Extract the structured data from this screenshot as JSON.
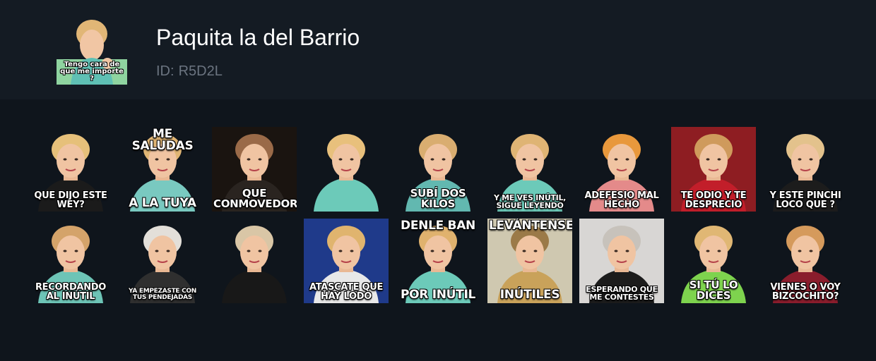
{
  "pack": {
    "title": "Paquita la del Barrio",
    "id_label": "ID:",
    "id_value": "R5D2L",
    "thumbnail_caption": "Tengo cara de que me importe ?"
  },
  "stickers": [
    {
      "top": "",
      "bottom": "Que dijo este wey?",
      "bg": "#0f151c",
      "shirt": "#1b1b1b",
      "hair": "#e6c07a"
    },
    {
      "top": "Me saludas",
      "bottom": "A la tuya",
      "bg": "#0f151c",
      "shirt": "#79c9c0",
      "hair": "#e0b574"
    },
    {
      "top": "",
      "bottom": "Que conmovedor",
      "bg": "#1a1410",
      "shirt": "#2a2420",
      "hair": "#9a6a48"
    },
    {
      "top": "",
      "bottom": "",
      "bg": "#0f151c",
      "shirt": "#6ccab9",
      "hair": "#e8c07c"
    },
    {
      "top": "",
      "bottom": "Subí dos kilos",
      "bg": "#0f151c",
      "shirt": "#62b8b0",
      "hair": "#d9ad70"
    },
    {
      "top": "",
      "bottom": "Y me ves inútil, sigue leyendo",
      "bg": "#0f151c",
      "shirt": "#6ccab9",
      "hair": "#dfb474"
    },
    {
      "top": "",
      "bottom": "Adefesio mal hecho",
      "bg": "#0f151c",
      "shirt": "#e48a8a",
      "hair": "#e8983c"
    },
    {
      "top": "",
      "bottom": "Te odio y te desprecio",
      "bg": "#8e1d22",
      "shirt": "#c21e2a",
      "hair": "#cf9a5c"
    },
    {
      "top": "",
      "bottom": "Y este pinchi loco que ?",
      "bg": "#0f151c",
      "shirt": "#1c1c1c",
      "hair": "#e3c28c"
    },
    {
      "top": "",
      "bottom": "Recordando al inútil",
      "bg": "#0f151c",
      "shirt": "#6dc4b6",
      "hair": "#d4a36a"
    },
    {
      "top": "",
      "bottom": "Ya empezaste con tus pendejadas",
      "bg": "#0f151c",
      "shirt": "#2f2f2f",
      "hair": "#e3dfd9"
    },
    {
      "top": "",
      "bottom": "",
      "bg": "#0f151c",
      "shirt": "#181818",
      "hair": "#d9c6a6"
    },
    {
      "top": "",
      "bottom": "Atascate que hay lodo",
      "bg": "#1f3a8a",
      "shirt": "#e8e8e8",
      "hair": "#e0b46e"
    },
    {
      "top": "Denle ban",
      "bottom": "Por inútil",
      "bg": "#0f151c",
      "shirt": "#6ccab9",
      "hair": "#e0b26e"
    },
    {
      "top": "Levántense",
      "bottom": "Inútiles",
      "bg": "#cfc8b0",
      "shirt": "#c9a25a",
      "hair": "#9b7a48"
    },
    {
      "top": "",
      "bottom": "Esperando que me contestes",
      "bg": "#d8d6d4",
      "shirt": "#1c1c1c",
      "hair": "#c7c2bb"
    },
    {
      "top": "",
      "bottom": "Si tú lo dices",
      "bg": "#0f151c",
      "shirt": "#7ed34e",
      "hair": "#e0b774"
    },
    {
      "top": "",
      "bottom": "Vienes o voy bizcochito?",
      "bg": "#0f151c",
      "shirt": "#8a1d2c",
      "hair": "#d59a5c"
    }
  ],
  "colors": {
    "page_bg": "#0f151c",
    "header_bg": "#141b23",
    "title": "#ffffff",
    "id_text": "#6b7480"
  }
}
